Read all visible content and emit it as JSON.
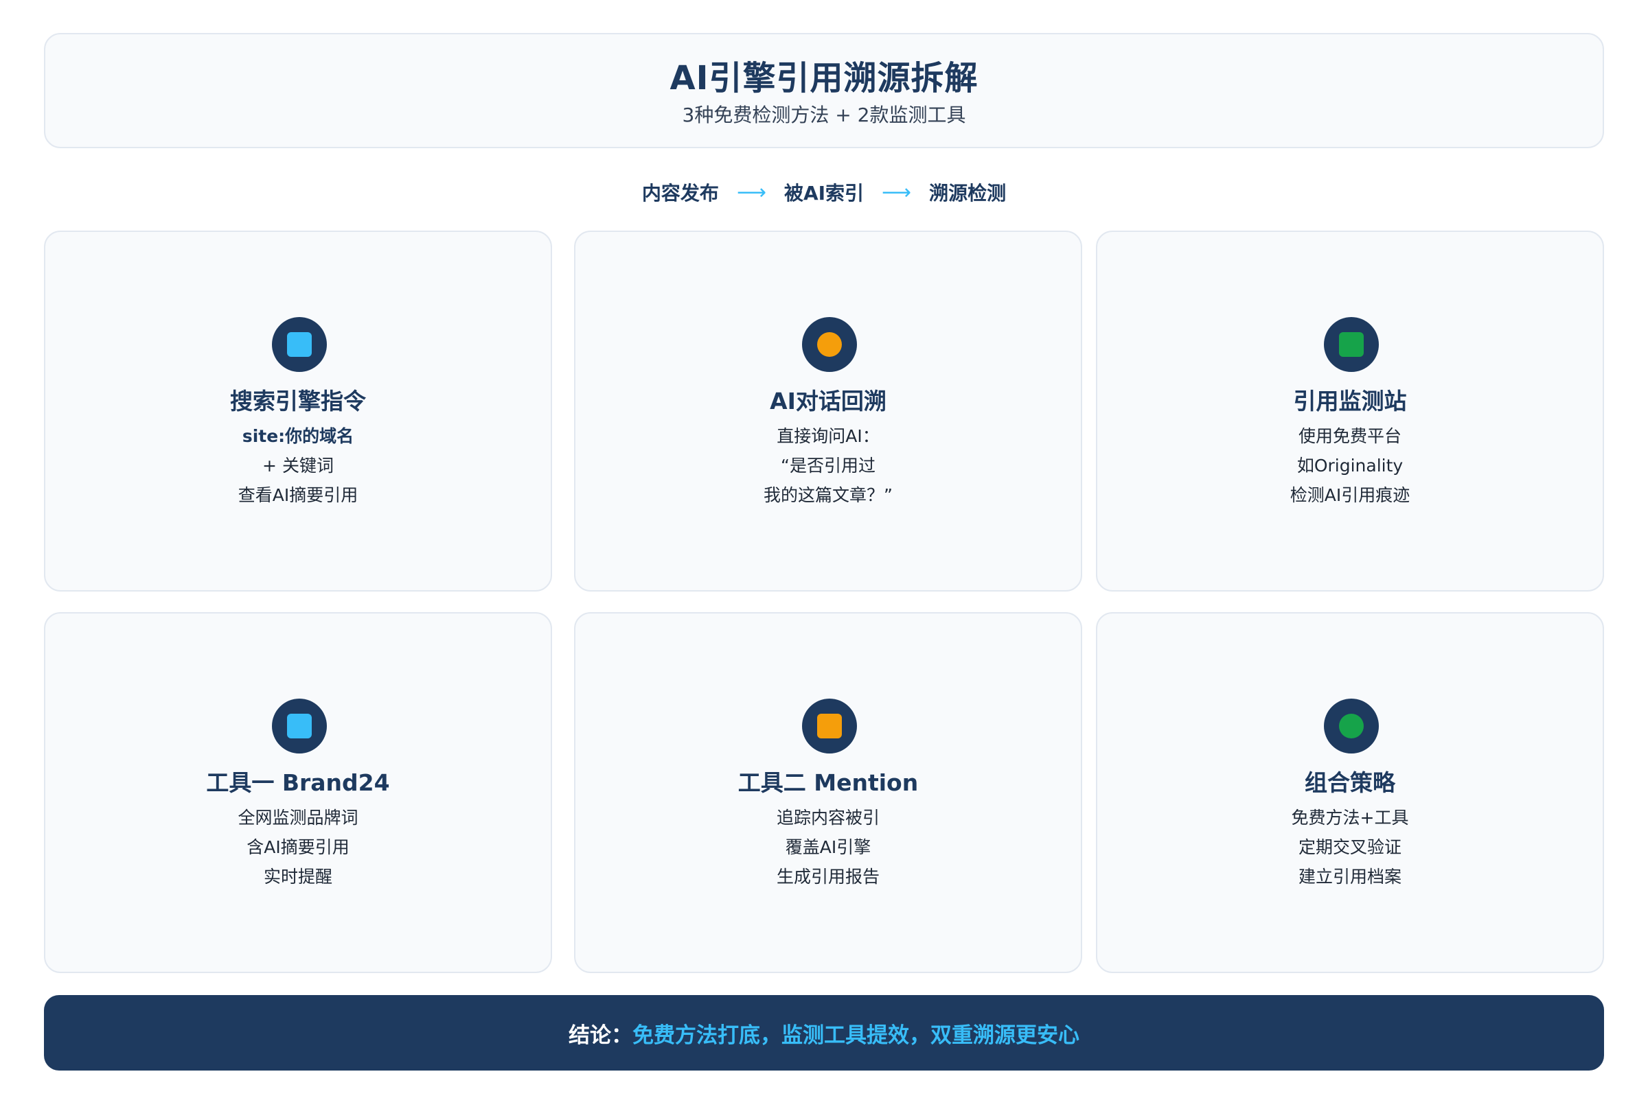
{
  "header": {
    "title": "AI引擎引用溯源拆解",
    "subtitle": "3种免费检测方法 + 2款监测工具"
  },
  "flow": {
    "steps": [
      "内容发布",
      "被AI索引",
      "溯源检测"
    ],
    "arrow": "⟶"
  },
  "cards": [
    {
      "icon": "blue-square-icon",
      "icon_color": "#38bdf8",
      "title": "搜索引擎指令",
      "lines": [
        "site:你的域名",
        "+ 关键词",
        "查看AI摘要引用"
      ]
    },
    {
      "icon": "orange-circle-icon",
      "icon_color": "#f59e0b",
      "title": "AI对话回溯",
      "lines": [
        "直接询问AI：",
        "“是否引用过",
        "我的这篇文章？”"
      ]
    },
    {
      "icon": "green-square-icon",
      "icon_color": "#16a34a",
      "title": "引用监测站",
      "lines": [
        "使用免费平台",
        "如Originality",
        "检测AI引用痕迹"
      ]
    },
    {
      "icon": "blue-square-icon",
      "icon_color": "#38bdf8",
      "title": "工具一 Brand24",
      "lines": [
        "全网监测品牌词",
        "含AI摘要引用",
        "实时提醒"
      ]
    },
    {
      "icon": "orange-square-icon",
      "icon_color": "#f59e0b",
      "title": "工具二 Mention",
      "lines": [
        "追踪内容被引",
        "覆盖AI引擎",
        "生成引用报告"
      ]
    },
    {
      "icon": "green-circle-icon",
      "icon_color": "#16a34a",
      "title": "组合策略",
      "lines": [
        "免费方法+工具",
        "定期交叉验证",
        "建立引用档案"
      ]
    }
  ],
  "footer": {
    "label": "结论：",
    "text": "免费方法打底，监测工具提效，双重溯源更安心"
  },
  "colors": {
    "navy": "#1e3a5f",
    "sky": "#38bdf8",
    "card_bg": "#f8fafc",
    "card_border": "#e2e8f0"
  }
}
